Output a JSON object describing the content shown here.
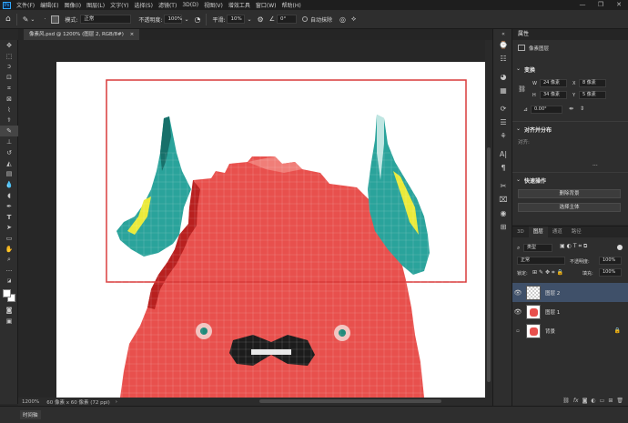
{
  "menu": {
    "logo": "Ps",
    "items": [
      "文件(F)",
      "编辑(E)",
      "图像(I)",
      "图层(L)",
      "文字(Y)",
      "选择(S)",
      "滤镜(T)",
      "3D(D)",
      "视图(V)",
      "增效工具",
      "窗口(W)",
      "帮助(H)"
    ]
  },
  "window_controls": [
    "—",
    "❐",
    "✕"
  ],
  "options": {
    "mode_label": "模式:",
    "mode_value": "正常",
    "opacity_label": "不透明度:",
    "opacity_value": "100%",
    "smooth_label": "平滑:",
    "smooth_value": "10%",
    "angle_value": "0°",
    "auto_erase": "自动抹除"
  },
  "document": {
    "tab": "像素风.psd @ 1200% (图层 2, RGB/8#)",
    "close": "×"
  },
  "status": {
    "zoom": "1200%",
    "size": "60 像素 x 60 像素 (72 ppi)",
    "arrow": "›"
  },
  "timeline": {
    "label": "时间轴"
  },
  "properties": {
    "title": "属性",
    "layer_type": "像素图层",
    "transform": "变换",
    "w": "W",
    "w_value": "24 像素",
    "x": "X",
    "x_value": "8 像素",
    "h": "H",
    "h_value": "34 像素",
    "y": "Y",
    "y_value": "5 像素",
    "angle": "0.00°",
    "align": "对齐并分布",
    "align_sub": "对齐:",
    "more": "...",
    "quick": "快速操作",
    "btn1": "删除背景",
    "btn2": "选择主体"
  },
  "layers_panel": {
    "tabs": [
      "3D",
      "图层",
      "通道",
      "路径"
    ],
    "filter": "类型",
    "blend": "正常",
    "opacity_label": "不透明度:",
    "opacity_value": "100%",
    "lock_label": "锁定:",
    "fill_label": "填充:",
    "fill_value": "100%",
    "layers": [
      {
        "name": "图层 2",
        "selected": true
      },
      {
        "name": "图层 1",
        "selected": false
      },
      {
        "name": "背景",
        "selected": false
      }
    ]
  },
  "colors": {
    "body_red": "#e8504d",
    "horn_teal": "#2aa39b",
    "horn_yellow": "#eaea3a",
    "selection": "#d93a3a"
  }
}
